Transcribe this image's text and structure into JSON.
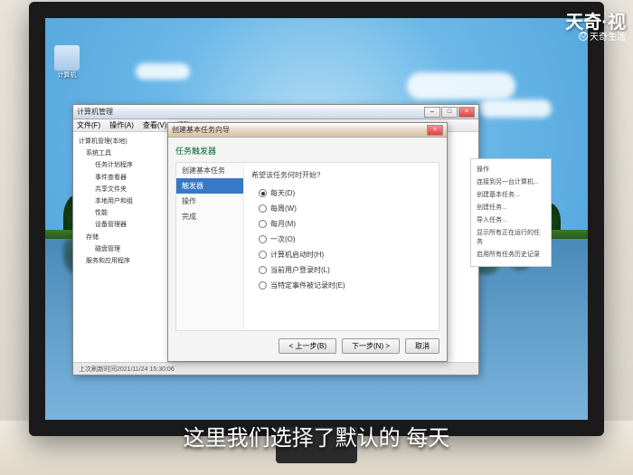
{
  "watermark": {
    "main": "天奇·视",
    "sub": "天奇生活"
  },
  "subtitle": "这里我们选择了默认的 每天",
  "desktop_icon": {
    "label": "计算机"
  },
  "main_window": {
    "title": "计算机管理",
    "menu": [
      "文件(F)",
      "操作(A)",
      "查看(V)",
      "帮助(H)"
    ],
    "tree": [
      {
        "label": "计算机管理(本地)",
        "lv": 0
      },
      {
        "label": "系统工具",
        "lv": 1
      },
      {
        "label": "任务计划程序",
        "lv": 2
      },
      {
        "label": "事件查看器",
        "lv": 2
      },
      {
        "label": "共享文件夹",
        "lv": 2
      },
      {
        "label": "本地用户和组",
        "lv": 2
      },
      {
        "label": "性能",
        "lv": 2
      },
      {
        "label": "设备管理器",
        "lv": 2
      },
      {
        "label": "存储",
        "lv": 1
      },
      {
        "label": "磁盘管理",
        "lv": 2
      },
      {
        "label": "服务和应用程序",
        "lv": 1
      }
    ],
    "right_items": [
      "操作",
      "连接到另一台计算机...",
      "创建基本任务...",
      "创建任务...",
      "导入任务...",
      "显示所有正在运行的任务",
      "启用所有任务历史记录"
    ],
    "footer": "上次刷新时间2021/11/24 15:30:06"
  },
  "dialog": {
    "title": "创建基本任务向导",
    "subtitle": "任务触发器",
    "nav": [
      "创建基本任务",
      "触发器",
      "操作",
      "完成"
    ],
    "nav_selected": 1,
    "header": "希望该任务何时开始?",
    "options": [
      {
        "label": "每天(D)",
        "checked": true
      },
      {
        "label": "每周(W)",
        "checked": false
      },
      {
        "label": "每月(M)",
        "checked": false
      },
      {
        "label": "一次(O)",
        "checked": false
      },
      {
        "label": "计算机启动时(H)",
        "checked": false
      },
      {
        "label": "当前用户登录时(L)",
        "checked": false
      },
      {
        "label": "当特定事件被记录时(E)",
        "checked": false
      }
    ],
    "buttons": {
      "back": "< 上一步(B)",
      "next": "下一步(N) >",
      "cancel": "取消"
    }
  }
}
